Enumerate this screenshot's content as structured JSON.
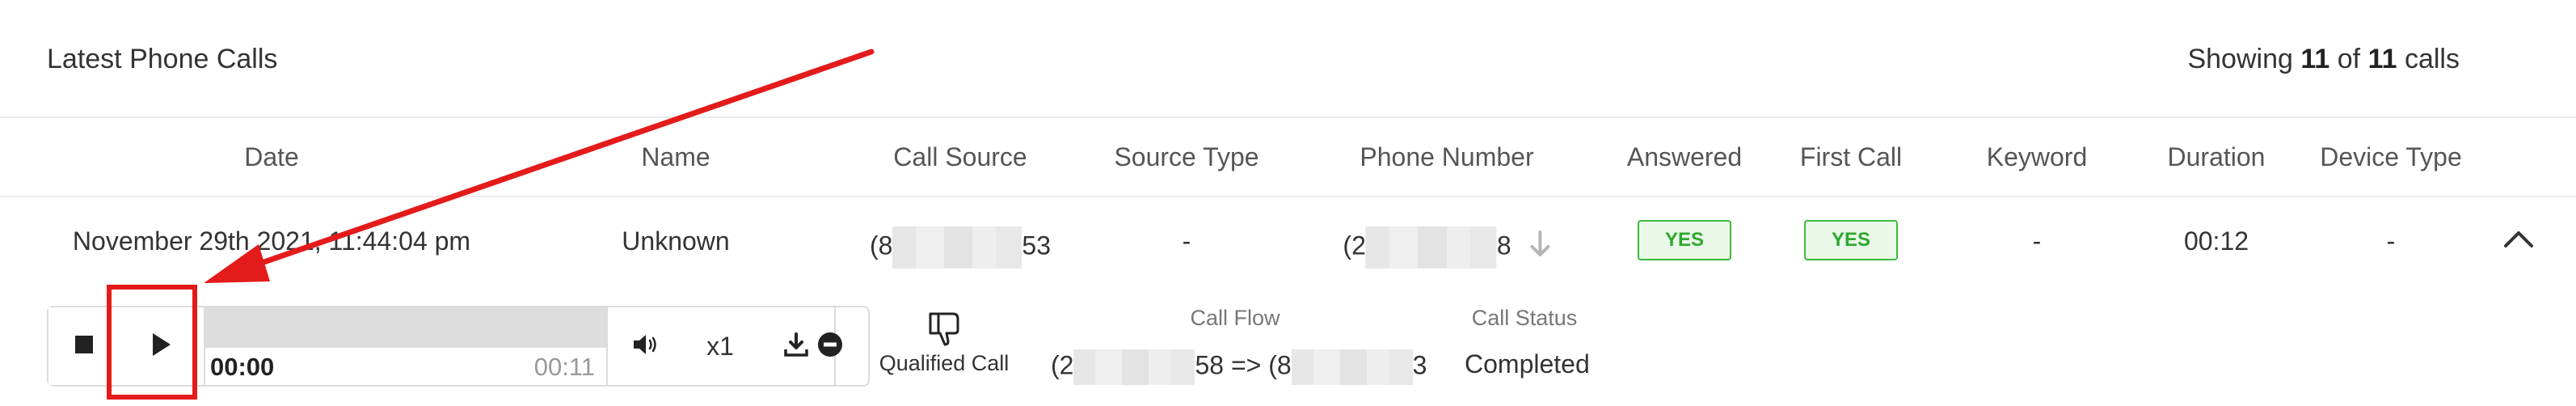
{
  "header": {
    "title": "Latest Phone Calls",
    "showing_prefix": "Showing",
    "showing_count": "11",
    "showing_of": "of",
    "showing_total": "11",
    "showing_suffix": "calls"
  },
  "table": {
    "columns": [
      "Date",
      "Name",
      "Call Source",
      "Source Type",
      "Phone Number",
      "Answered",
      "First Call",
      "Keyword",
      "Duration",
      "Device Type"
    ],
    "row": {
      "date": "November 29th 2021, 11:44:04 pm",
      "name": "Unknown",
      "call_source_prefix": "(8",
      "call_source_suffix": "53",
      "source_type": "-",
      "phone_prefix": "(2",
      "phone_suffix": "8",
      "answered": "YES",
      "first_call": "YES",
      "keyword": "-",
      "duration": "00:12",
      "device_type": "-"
    }
  },
  "player": {
    "current_time": "00:00",
    "total_time": "00:11",
    "speed": "x1",
    "progress": 0.0
  },
  "details": {
    "qualified_label": "Qualified Call",
    "call_flow_label": "Call Flow",
    "call_flow_from": "(2",
    "call_flow_mid": "58 => (8",
    "call_flow_to": "3",
    "call_status_label": "Call Status",
    "call_status": "Completed"
  },
  "colors": {
    "badge_green": "#2ea82e",
    "annotation_red": "#e41b1b"
  }
}
